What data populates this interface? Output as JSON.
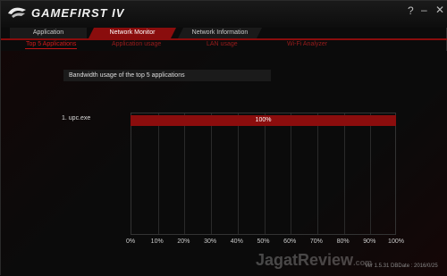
{
  "window": {
    "title": "GAMEFIRST IV",
    "controls": {
      "help": "?",
      "minimize": "–",
      "close": "✕"
    }
  },
  "tabs": [
    "Application",
    "Network Monitor",
    "Network Information"
  ],
  "subtabs": [
    "Top 5 Applications",
    "Application usage",
    "LAN usage",
    "Wi-Fi Analyzer"
  ],
  "chart": {
    "title": "Bandwidth usage of the top 5 applications",
    "app_label": "1. upc.exe",
    "bar_label": "100%",
    "ticks": [
      "0%",
      "10%",
      "20%",
      "30%",
      "40%",
      "50%",
      "60%",
      "70%",
      "80%",
      "90%",
      "100%"
    ]
  },
  "chart_data": {
    "type": "bar",
    "categories": [
      "1. upc.exe"
    ],
    "values": [
      100
    ],
    "title": "Bandwidth usage of the top 5 applications",
    "xlim": [
      0,
      100
    ]
  },
  "watermark": {
    "main": "JagatReview",
    "suffix": ".com"
  },
  "footer": {
    "version": "Ver 1.5.31   DBDate : 2016/0/25"
  }
}
